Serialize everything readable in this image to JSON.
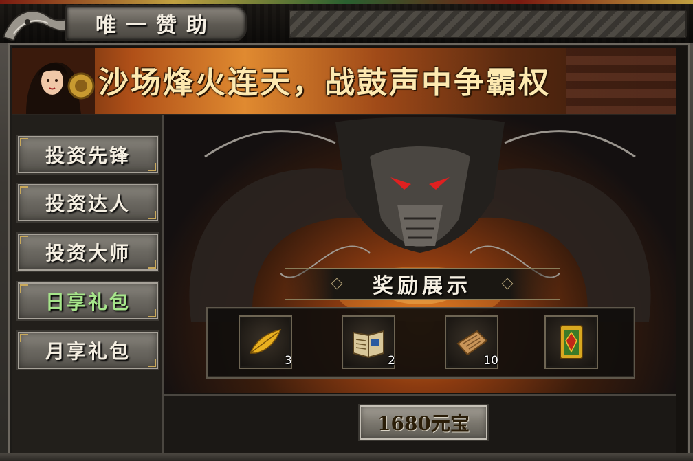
{
  "window": {
    "title": "唯一赞助"
  },
  "banner": {
    "slogan": "沙场烽火连天，战鼓声中争霸权"
  },
  "sidebar": {
    "items": [
      {
        "label": "投资先锋",
        "style": "normal"
      },
      {
        "label": "投资达人",
        "style": "normal"
      },
      {
        "label": "投资大师",
        "style": "normal"
      },
      {
        "label": "日享礼包",
        "style": "selected-green"
      },
      {
        "label": "月享礼包",
        "style": "normal"
      }
    ]
  },
  "rewards": {
    "title": "奖励展示",
    "items": [
      {
        "icon": "golden-feather-icon",
        "count": "3"
      },
      {
        "icon": "skill-book-icon",
        "count": "2"
      },
      {
        "icon": "scroll-icon",
        "count": "10"
      },
      {
        "icon": "golden-card-icon",
        "count": ""
      }
    ]
  },
  "purchase": {
    "price_label": "1680元宝"
  },
  "colors": {
    "title_text": "#f4eee2",
    "selected_item_text": "#a6e58a",
    "slogan_text": "#fde9b0",
    "panel_bg": "#15120f"
  }
}
